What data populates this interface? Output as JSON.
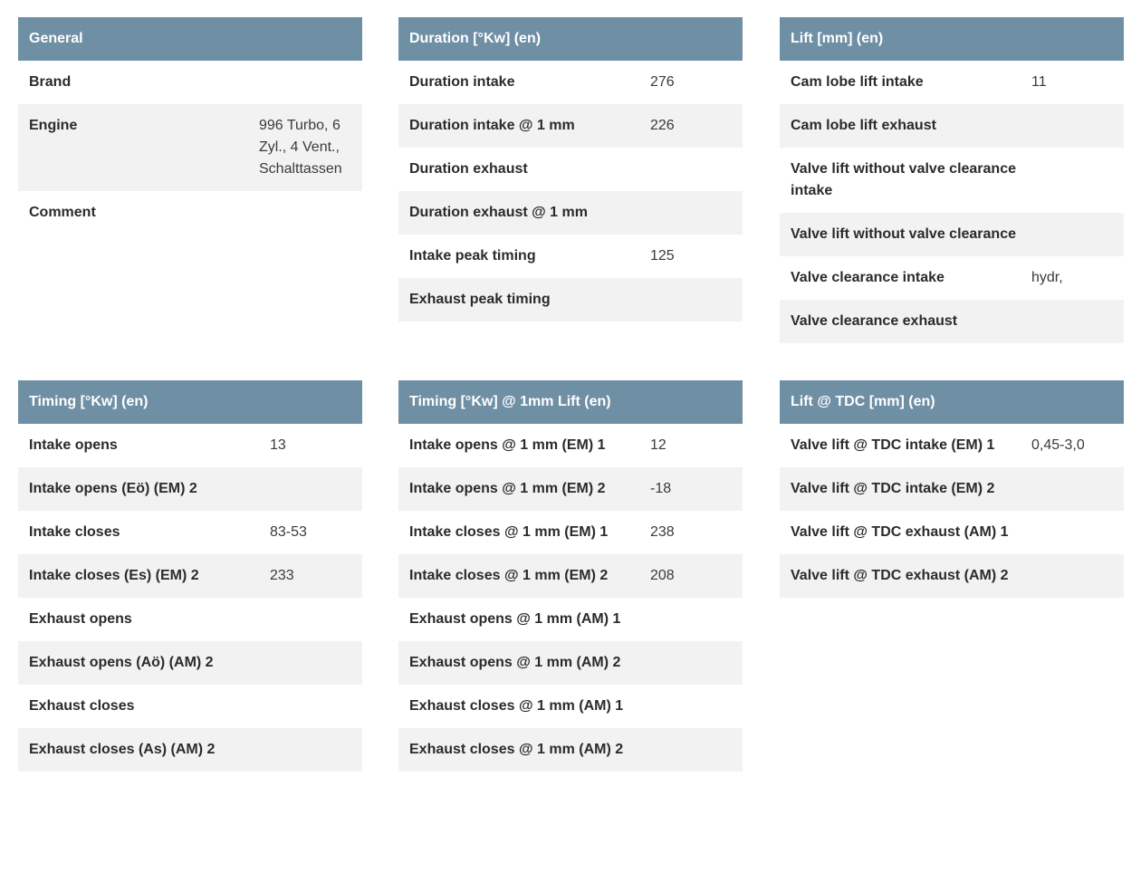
{
  "general": {
    "title": "General",
    "rows": [
      {
        "label": "Brand",
        "value": ""
      },
      {
        "label": "Engine",
        "value": "996 Turbo, 6 Zyl., 4 Vent., Schalttassen"
      },
      {
        "label": "Comment",
        "value": ""
      }
    ]
  },
  "duration": {
    "title": "Duration [°Kw] (en)",
    "rows": [
      {
        "label": "Duration intake",
        "value": "276"
      },
      {
        "label": "Duration intake @ 1 mm",
        "value": "226"
      },
      {
        "label": "Duration exhaust",
        "value": ""
      },
      {
        "label": "Duration exhaust @ 1 mm",
        "value": ""
      },
      {
        "label": "Intake peak timing",
        "value": "125"
      },
      {
        "label": "Exhaust peak timing",
        "value": ""
      }
    ]
  },
  "lift": {
    "title": "Lift [mm] (en)",
    "rows": [
      {
        "label": "Cam lobe lift intake",
        "value": "11"
      },
      {
        "label": "Cam lobe lift exhaust",
        "value": ""
      },
      {
        "label": "Valve lift without valve clearance intake",
        "value": ""
      },
      {
        "label": "Valve lift without valve clearance",
        "value": ""
      },
      {
        "label": "Valve clearance intake",
        "value": "hydr,"
      },
      {
        "label": "Valve clearance exhaust",
        "value": ""
      }
    ]
  },
  "timing": {
    "title": "Timing [°Kw] (en)",
    "rows": [
      {
        "label": "Intake opens",
        "value": "13"
      },
      {
        "label": "Intake opens (Eö) (EM) 2",
        "value": ""
      },
      {
        "label": "Intake closes",
        "value": "83-53"
      },
      {
        "label": "Intake closes (Es) (EM) 2",
        "value": "233"
      },
      {
        "label": "Exhaust opens",
        "value": ""
      },
      {
        "label": "Exhaust opens (Aö) (AM) 2",
        "value": ""
      },
      {
        "label": "Exhaust closes",
        "value": ""
      },
      {
        "label": "Exhaust closes (As) (AM) 2",
        "value": ""
      }
    ]
  },
  "timing_1mm": {
    "title": "Timing [°Kw] @ 1mm Lift (en)",
    "rows": [
      {
        "label": "Intake opens @ 1 mm (EM) 1",
        "value": "12"
      },
      {
        "label": "Intake opens @ 1 mm (EM) 2",
        "value": "-18"
      },
      {
        "label": "Intake closes @ 1 mm (EM) 1",
        "value": "238"
      },
      {
        "label": "Intake closes @ 1 mm (EM) 2",
        "value": "208"
      },
      {
        "label": "Exhaust opens @ 1 mm (AM) 1",
        "value": ""
      },
      {
        "label": "Exhaust opens @ 1 mm (AM) 2",
        "value": ""
      },
      {
        "label": "Exhaust closes @ 1 mm (AM) 1",
        "value": ""
      },
      {
        "label": "Exhaust closes @ 1 mm (AM) 2",
        "value": ""
      }
    ]
  },
  "lift_tdc": {
    "title": "Lift @ TDC [mm] (en)",
    "rows": [
      {
        "label": "Valve lift @ TDC intake (EM) 1",
        "value": "0,45-3,0"
      },
      {
        "label": "Valve lift @ TDC intake (EM) 2",
        "value": ""
      },
      {
        "label": "Valve lift @ TDC exhaust (AM) 1",
        "value": ""
      },
      {
        "label": "Valve lift @ TDC exhaust (AM) 2",
        "value": ""
      }
    ]
  },
  "colors": {
    "header_bg": "#6f8fa5",
    "stripe_bg": "#f2f2f2"
  }
}
